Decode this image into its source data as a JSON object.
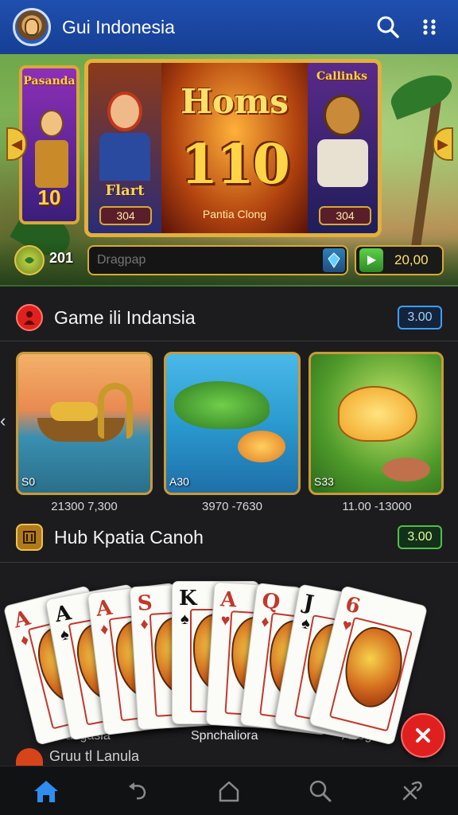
{
  "header": {
    "title": "Gui Indonesia",
    "icons": [
      "logo-avatar",
      "search-icon",
      "more-icon"
    ]
  },
  "banner": {
    "left_card": {
      "title": "Pasanda",
      "number": "10"
    },
    "hero": {
      "title": "Homs",
      "number": "110",
      "subtitle": "Pantia Clong",
      "left_label": "Flart",
      "left_pill": "304",
      "right_pill": "304"
    },
    "right_card": {
      "title": "Callinks"
    },
    "coins": "201",
    "search_placeholder": "Dragpap",
    "play_value": "20,00"
  },
  "sections": [
    {
      "title": "Game ili Indansia",
      "badge": "3.00",
      "accent": "#e0201f",
      "badge_color": "#3aa0ff"
    },
    {
      "title": "Hub Kpatia Canoh",
      "badge": "3.00",
      "accent": "#d4a23a",
      "badge_color": "#4fc04a"
    }
  ],
  "games": [
    {
      "tag": "S0",
      "range": "21300 7,300"
    },
    {
      "tag": "A30",
      "range": "3970 -7630"
    },
    {
      "tag": "S33",
      "range": "11.00 -13000"
    }
  ],
  "playing_cards": [
    {
      "rank": "A",
      "suit": "♦",
      "color": "#c0392b"
    },
    {
      "rank": "A",
      "suit": "♠",
      "color": "#111111"
    },
    {
      "rank": "A",
      "suit": "♦",
      "color": "#c0392b"
    },
    {
      "rank": "S",
      "suit": "♦",
      "color": "#c0392b"
    },
    {
      "rank": "K",
      "suit": "♠",
      "color": "#111111"
    },
    {
      "rank": "A",
      "suit": "♥",
      "color": "#c0392b"
    },
    {
      "rank": "Q",
      "suit": "♦",
      "color": "#c0392b"
    },
    {
      "rank": "J",
      "suit": "♠",
      "color": "#111111"
    },
    {
      "rank": "6",
      "suit": "♥",
      "color": "#c0392b"
    }
  ],
  "card_captions": [
    "Pangasia",
    "Spnchaliora",
    "Abogaitic"
  ],
  "peek_section": "Gruu tl Lanula",
  "bottom_nav": [
    "home-icon",
    "back-icon",
    "house-icon",
    "search-icon",
    "tools-icon"
  ]
}
